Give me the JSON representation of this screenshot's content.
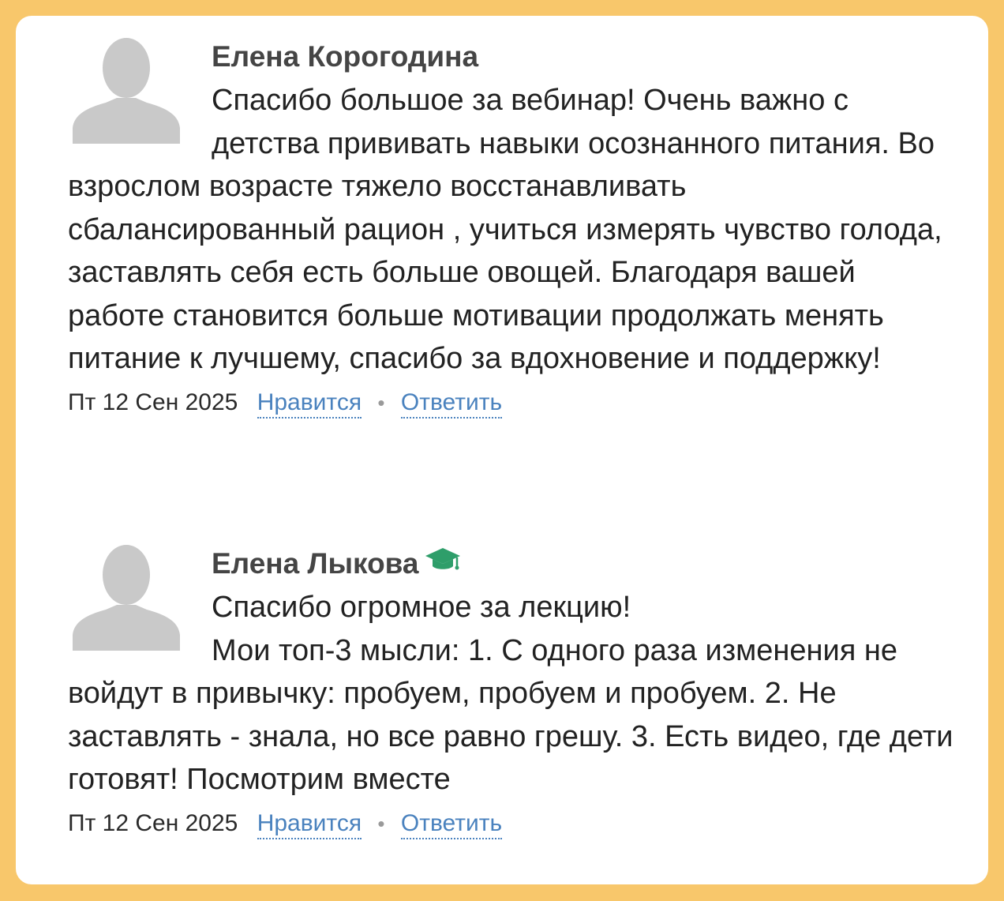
{
  "comments": [
    {
      "author": "Елена Корогодина",
      "badge": null,
      "paragraphs": [
        "Спасибо большое за вебинар! Очень важно с детства прививать навыки осознанного питания. Во взрослом возрасте тяжело восстанавливать сбалансированный рацион , учиться измерять чувство голода, заставлять себя есть больше овощей. Благодаря вашей работе становится больше мотивации продолжать менять питание к лучшему, спасибо за вдохновение и поддержку!"
      ],
      "date": "Пт 12 Сен 2025",
      "like_label": "Нравится",
      "separator": "•",
      "reply_label": "Ответить"
    },
    {
      "author": "Елена Лыкова",
      "badge": "graduation-cap-icon",
      "paragraphs": [
        "Спасибо огромное за лекцию!",
        "Мои топ-3 мысли: 1. С одного раза изменения не войдут в привычку: пробуем, пробуем и пробуем. 2. Не заставлять - знала, но все равно грешу. 3. Есть видео, где дети готовят! Посмотрим вместе"
      ],
      "date": "Пт 12 Сен 2025",
      "like_label": "Нравится",
      "separator": "•",
      "reply_label": "Ответить"
    }
  ],
  "colors": {
    "frame": "#f8c76b",
    "link": "#4a82be",
    "badge": "#2e9e6a",
    "avatar": "#c9c9c9"
  }
}
